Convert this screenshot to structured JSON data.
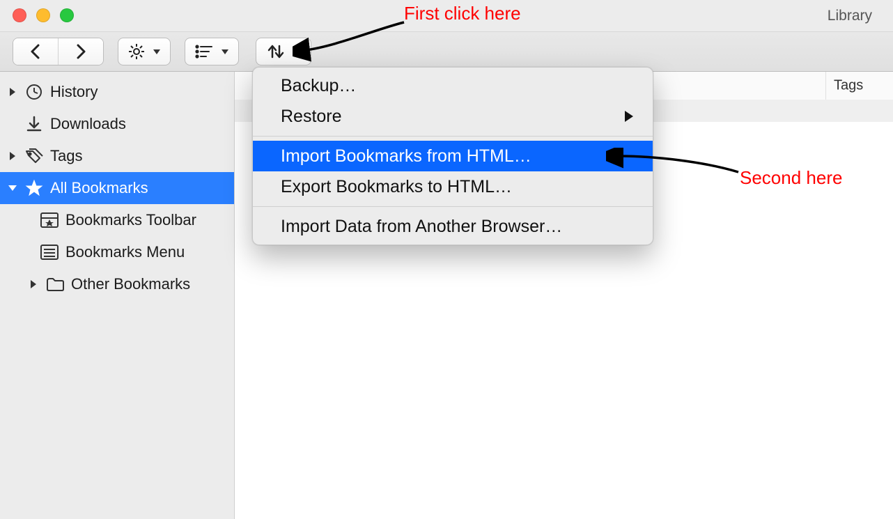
{
  "window": {
    "title": "Library"
  },
  "sidebar": {
    "history": "History",
    "downloads": "Downloads",
    "tags": "Tags",
    "all_bookmarks": "All Bookmarks",
    "bookmarks_toolbar": "Bookmarks Toolbar",
    "bookmarks_menu": "Bookmarks Menu",
    "other_bookmarks": "Other Bookmarks"
  },
  "columns": {
    "tags": "Tags"
  },
  "menu": {
    "backup": "Backup…",
    "restore": "Restore",
    "import_html": "Import Bookmarks from HTML…",
    "export_html": "Export Bookmarks to HTML…",
    "import_browser": "Import Data from Another Browser…"
  },
  "annotations": {
    "first": "First click here",
    "second": "Second here"
  }
}
